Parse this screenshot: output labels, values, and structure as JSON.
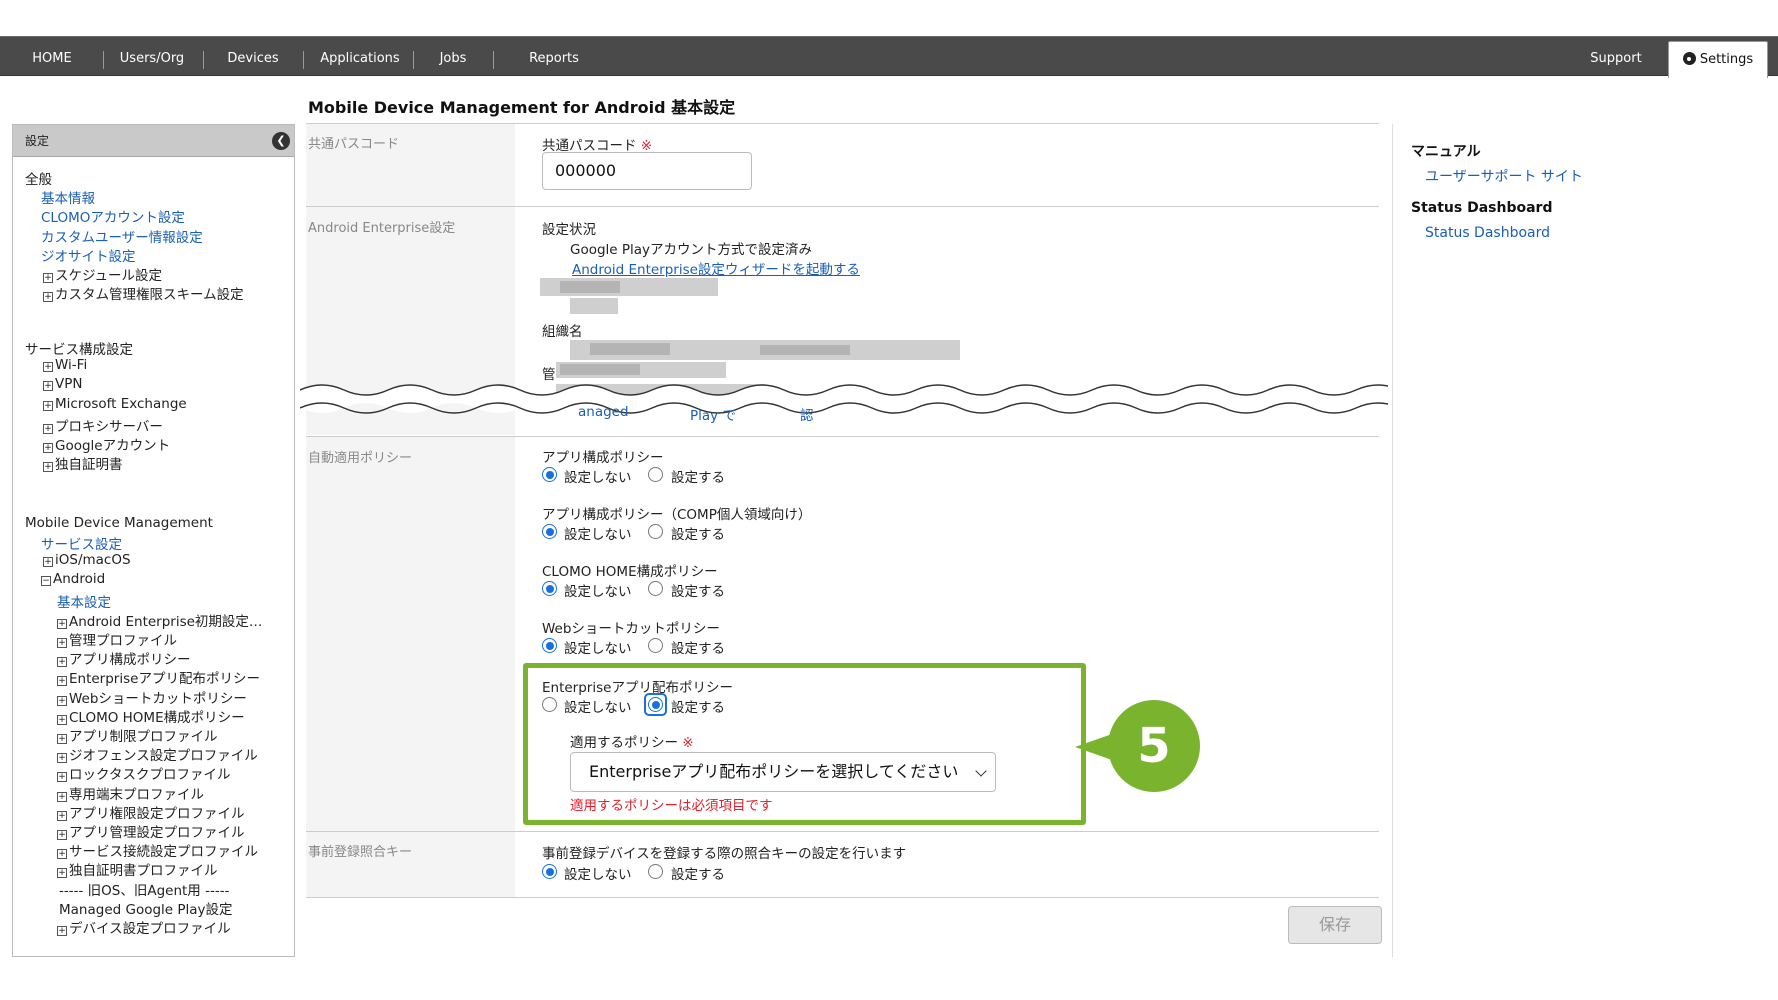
{
  "nav": {
    "items": [
      "HOME",
      "Users/Org",
      "Devices",
      "Applications",
      "Jobs",
      "Reports"
    ],
    "support": "Support",
    "settings": "Settings"
  },
  "page_title": "Mobile Device Management for Android 基本設定",
  "sidebar": {
    "header": "設定",
    "sections": [
      {
        "title": "全般",
        "items": [
          {
            "label": "基本情報",
            "link": true
          },
          {
            "label": "CLOMOアカウント設定",
            "link": true
          },
          {
            "label": "カスタムユーザー情報設定",
            "link": true
          },
          {
            "label": "ジオサイト設定",
            "link": true
          },
          {
            "label": "スケジュール設定",
            "expand": true
          },
          {
            "label": "カスタム管理権限スキーム設定",
            "expand": true
          }
        ]
      },
      {
        "title": "サービス構成設定",
        "items": [
          {
            "label": "Wi-Fi",
            "expand": true
          },
          {
            "label": "VPN",
            "expand": true
          },
          {
            "label": "Microsoft Exchange",
            "expand": true
          },
          {
            "label": "プロキシサーバー",
            "expand": true
          },
          {
            "label": "Googleアカウント",
            "expand": true
          },
          {
            "label": "独自証明書",
            "expand": true
          }
        ]
      },
      {
        "title": "Mobile Device Management",
        "items": [
          {
            "label": "サービス設定",
            "link": true
          },
          {
            "label": "iOS/macOS",
            "expand": true
          },
          {
            "label": "Android",
            "collapse": true
          },
          {
            "label": "基本設定",
            "link": true
          },
          {
            "label": "Android Enterprise初期設定…",
            "expand": true
          },
          {
            "label": "管理プロファイル",
            "expand": true
          },
          {
            "label": "アプリ構成ポリシー",
            "expand": true
          },
          {
            "label": "Enterpriseアプリ配布ポリシー",
            "expand": true
          },
          {
            "label": "Webショートカットポリシー",
            "expand": true
          },
          {
            "label": "CLOMO HOME構成ポリシー",
            "expand": true
          },
          {
            "label": "アプリ制限プロファイル",
            "expand": true
          },
          {
            "label": "ジオフェンス設定プロファイル",
            "expand": true
          },
          {
            "label": "ロックタスクプロファイル",
            "expand": true
          },
          {
            "label": "専用端末プロファイル",
            "expand": true
          },
          {
            "label": "アプリ権限設定プロファイル",
            "expand": true
          },
          {
            "label": "アプリ管理設定プロファイル",
            "expand": true
          },
          {
            "label": "サービス接続設定プロファイル",
            "expand": true
          },
          {
            "label": "独自証明書プロファイル",
            "expand": true
          },
          {
            "label": "----- 旧OS、旧Agent用 -----"
          },
          {
            "label": "Managed Google Play設定"
          },
          {
            "label": "デバイス設定プロファイル",
            "expand": true
          }
        ]
      }
    ]
  },
  "passcode": {
    "row_label": "共通パスコード",
    "field_label": "共通パスコード",
    "required_mark": "※",
    "value": "000000"
  },
  "android_enterprise": {
    "row_label": "Android Enterprise設定",
    "status_label": "設定状況",
    "status_value": "Google Playアカウント方式で設定済み",
    "wizard_link": "Android Enterprise設定ウィザードを起動する",
    "org_label": "組織名",
    "admin_label_partial": "管",
    "fragment_a": "anaged",
    "fragment_b": "Play で",
    "fragment_c": "認"
  },
  "auto_policy": {
    "row_label": "自動適用ポリシー",
    "opt_off": "設定しない",
    "opt_on": "設定する",
    "policies": [
      {
        "label": "アプリ構成ポリシー",
        "selected": "off"
      },
      {
        "label": "アプリ構成ポリシー（COMP個人領域向け）",
        "selected": "off"
      },
      {
        "label": "CLOMO HOME構成ポリシー",
        "selected": "off"
      },
      {
        "label": "Webショートカットポリシー",
        "selected": "off"
      }
    ],
    "enterprise": {
      "label": "Enterpriseアプリ配布ポリシー",
      "selected": "on",
      "apply_label": "適用するポリシー",
      "required_mark": "※",
      "select_placeholder": "Enterpriseアプリ配布ポリシーを選択してください",
      "error": "適用するポリシーは必須項目です"
    }
  },
  "prereg": {
    "row_label": "事前登録照合キー",
    "desc": "事前登録デバイスを登録する際の照合キーの設定を行います",
    "selected": "off"
  },
  "save_label": "保存",
  "callout_number": "5",
  "right_panel": {
    "manual_title": "マニュアル",
    "manual_link": "ユーザーサポート サイト",
    "status_title": "Status Dashboard",
    "status_link": "Status Dashboard"
  },
  "colors": {
    "nav_bg": "#4a4a4a",
    "link": "#1a5fb4",
    "highlight": "#7ab32e",
    "error": "#e0202a",
    "radio": "#1a6fe0"
  }
}
